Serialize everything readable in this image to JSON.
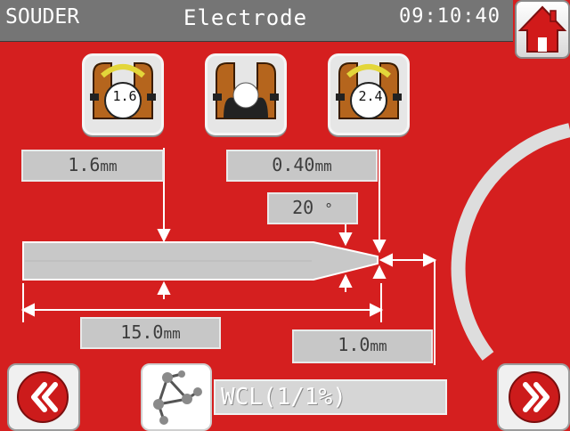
{
  "header": {
    "app_name": "SOUDER",
    "title": "Electrode",
    "time": "09:10:40"
  },
  "icons": {
    "home": "home-icon",
    "back": "double-chevron-left-icon",
    "forward": "double-chevron-right-icon",
    "molecule": "molecule-icon"
  },
  "electrode_buttons": [
    {
      "name": "electrode-1-6",
      "label": "1.6"
    },
    {
      "name": "electrode-empty",
      "label": ""
    },
    {
      "name": "electrode-2-4",
      "label": "2.4"
    }
  ],
  "dimensions": {
    "diameter": {
      "value": "1.6",
      "unit": "mm"
    },
    "tip": {
      "value": "0.40",
      "unit": "mm"
    },
    "angle": {
      "value": "20",
      "unit": "°"
    },
    "length": {
      "value": "15.0",
      "unit": "mm"
    },
    "gap": {
      "value": "1.0",
      "unit": "mm"
    }
  },
  "material": {
    "value": "WCL(1/1%)"
  },
  "colors": {
    "background": "#d51f1f",
    "header": "#757575",
    "box": "#c7c7c7",
    "electrode": "#c8c8c8",
    "home_roof": "#d11a1a"
  }
}
